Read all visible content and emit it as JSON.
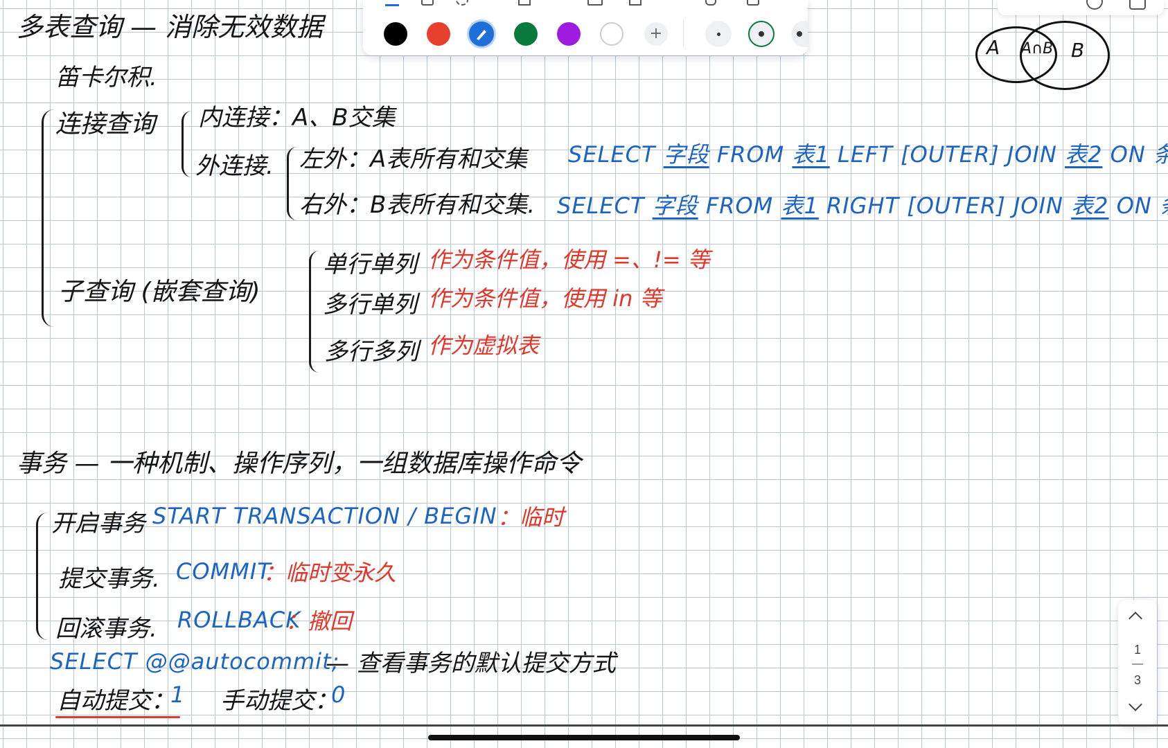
{
  "toolbar": {
    "colors": [
      "#000000",
      "#e8402f",
      "#1f6fd8",
      "#0a7a3c",
      "#a01be0",
      "#ffffff"
    ],
    "add_label": "+"
  },
  "notes": {
    "title": "多表查询 — 消除无效数据",
    "cartesian": "笛卡尔积.",
    "join_query": "连接查询",
    "inner_join": "内连接：A、B交集",
    "outer_join": "外连接.",
    "left_outer": "左外：A表所有和交集",
    "right_outer": "右外：B表所有和交集.",
    "sql_left_a": "SELECT",
    "sql_left_field": "字段",
    "sql_left_from": "FROM",
    "sql_left_t1": "表1",
    "sql_left_join": "LEFT [OUTER] JOIN",
    "sql_left_t2": "表2",
    "sql_left_on": "ON 条件",
    "sql_right_a": "SELECT",
    "sql_right_field": "字段",
    "sql_right_from": "FROM",
    "sql_right_t1": "表1",
    "sql_right_join": "RIGHT [OUTER] JOIN",
    "sql_right_t2": "表2",
    "sql_right_on": "ON 条件",
    "subquery": "子查询 (嵌套查询)",
    "sub_single": "单行单列",
    "sub_single_note": "作为条件值，使用 =、!= 等",
    "sub_multi": "多行单列",
    "sub_multi_note": "作为条件值，使用 in 等",
    "sub_multicol": "多行多列",
    "sub_multicol_note": "作为虚拟表",
    "venn_a": "A",
    "venn_ab": "A∩B",
    "venn_b": "B",
    "transaction": "事务 — 一种机制、操作序列，一组数据库操作命令",
    "start_tx": "开启事务",
    "start_tx_sql": "START TRANSACTION / BEGIN",
    "start_tx_note": "：临时",
    "commit_tx": "提交事务.",
    "commit_sql": "COMMIT",
    "commit_note": "：临时变永久",
    "rollback_tx": "回滚事务.",
    "rollback_sql": "ROLLBACK",
    "rollback_note": "：撤回",
    "autocommit_sql": "SELECT @@autocommit;",
    "autocommit_note": "— 查看事务的默认提交方式",
    "auto_label": "自动提交：",
    "auto_value": "1",
    "manual_label": "手动提交：",
    "manual_value": "0"
  },
  "pager": {
    "current": "1",
    "separator": "—",
    "total": "3"
  }
}
